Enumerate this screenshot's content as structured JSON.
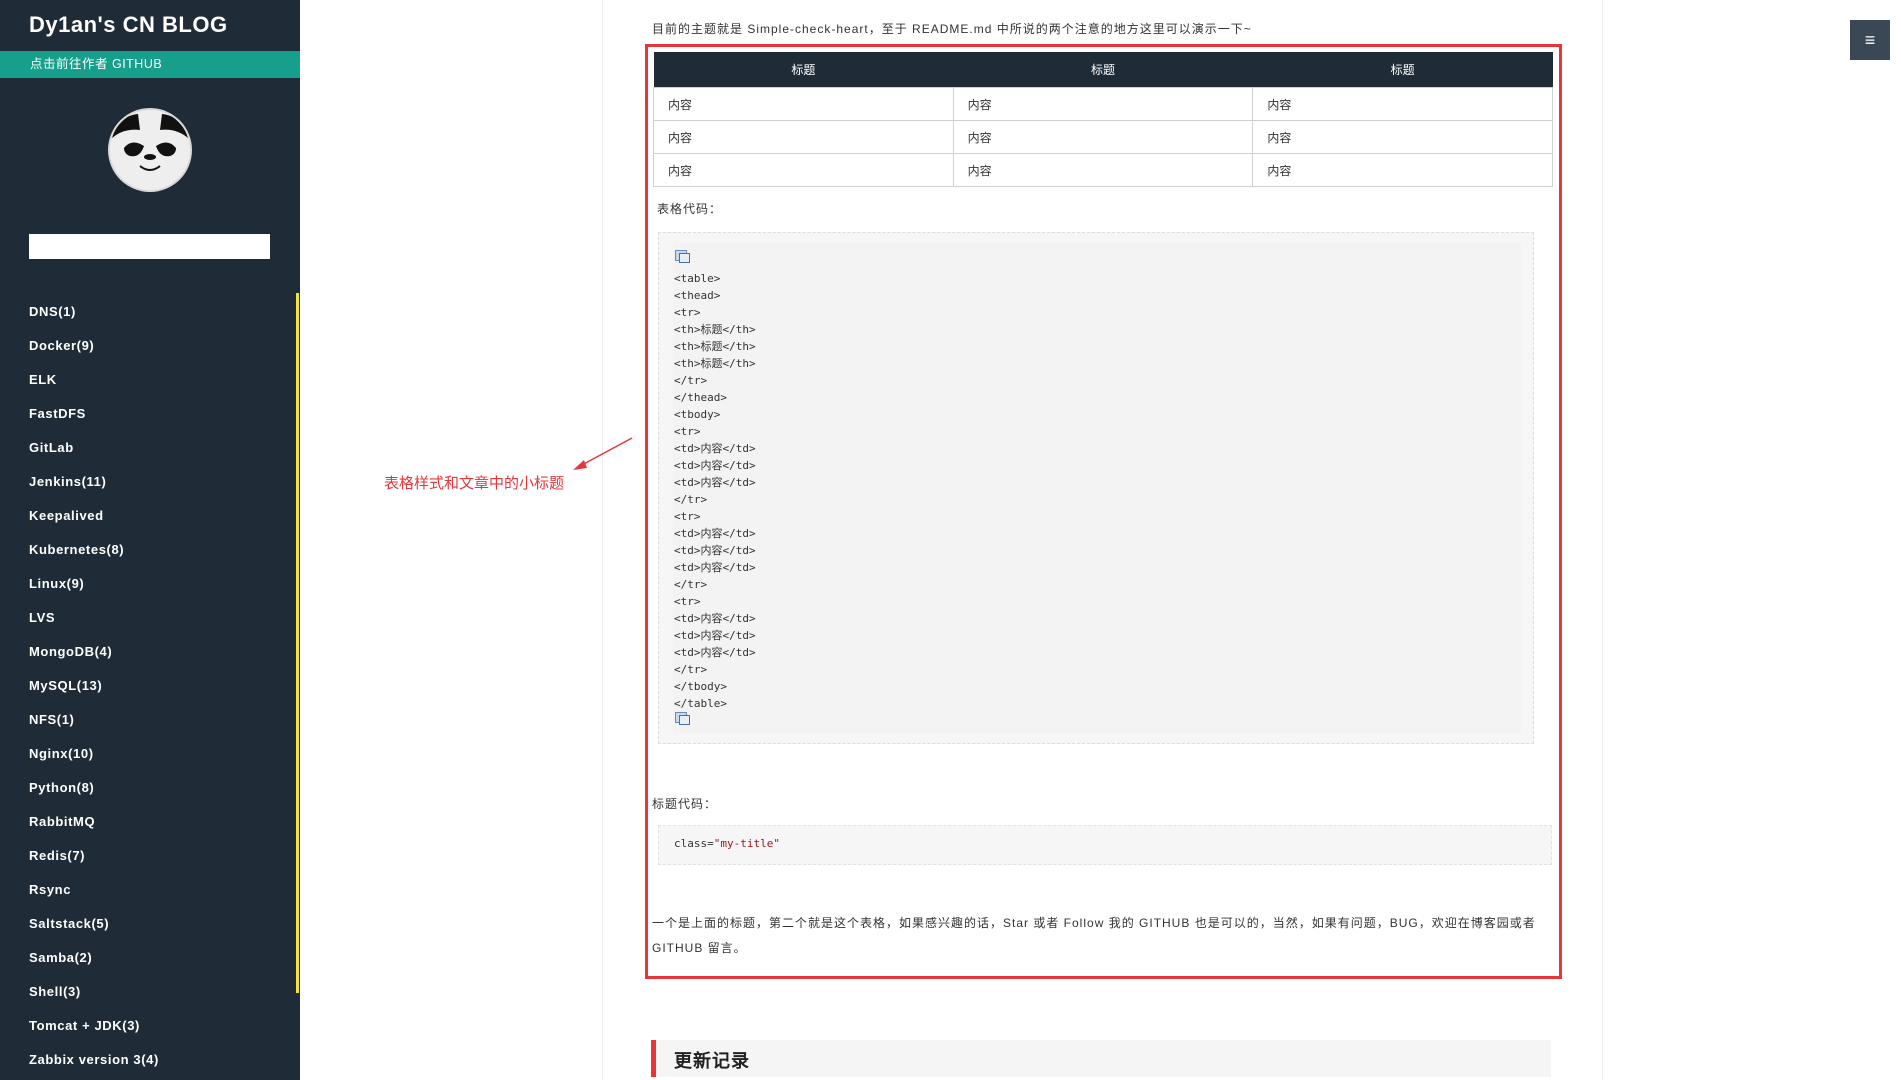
{
  "site": {
    "title": "Dy1an's CN BLOG",
    "github_link": "点击前往作者 GITHUB",
    "search_placeholder": "",
    "avatar_icon": "panda-avatar-icon",
    "accent_color": "#169f8a",
    "sidebar_bg": "#1f2c38"
  },
  "categories": [
    "DNS(1)",
    "Docker(9)",
    "ELK",
    "FastDFS",
    "GitLab",
    "Jenkins(11)",
    "Keepalived",
    "Kubernetes(8)",
    "Linux(9)",
    "LVS",
    "MongoDB(4)",
    "MySQL(13)",
    "NFS(1)",
    "Nginx(10)",
    "Python(8)",
    "RabbitMQ",
    "Redis(7)",
    "Rsync",
    "Saltstack(5)",
    "Samba(2)",
    "Shell(3)",
    "Tomcat + JDK(3)",
    "Zabbix version 3(4)"
  ],
  "article": {
    "intro": "目前的主题就是 Simple-check-heart，至于 README.md 中所说的两个注意的地方这里可以演示一下~",
    "table": {
      "headers": [
        "标题",
        "标题",
        "标题"
      ],
      "rows": [
        [
          "内容",
          "内容",
          "内容"
        ],
        [
          "内容",
          "内容",
          "内容"
        ],
        [
          "内容",
          "内容",
          "内容"
        ]
      ]
    },
    "table_code_label": "表格代码：",
    "table_code_lines": [
      "<table>",
      "<thead>",
      "<tr>",
      "<th>标题</th>",
      "<th>标题</th>",
      "<th>标题</th>",
      "</tr>",
      "</thead>",
      "<tbody>",
      "<tr>",
      "<td>内容</td>",
      "<td>内容</td>",
      "<td>内容</td>",
      "</tr>",
      "<tr>",
      "<td>内容</td>",
      "<td>内容</td>",
      "<td>内容</td>",
      "</tr>",
      "<tr>",
      "<td>内容</td>",
      "<td>内容</td>",
      "<td>内容</td>",
      "</tr>",
      "</tbody>",
      "</table>"
    ],
    "title_code_label": "标题代码：",
    "title_code_attr": "class=",
    "title_code_value": "\"my-title\"",
    "paragraph": "一个是上面的标题，第二个就是这个表格，如果感兴趣的话，Star 或者 Follow 我的 GITHUB 也是可以的，当然，如果有问题，BUG，欢迎在博客园或者 GITHUB 留言。",
    "section_heading": "更新记录"
  },
  "annotation": {
    "text": "表格样式和文章中的小标题",
    "color": "#e8353b"
  },
  "menu_button": {
    "label": "≡",
    "icon": "hamburger-menu-icon"
  }
}
